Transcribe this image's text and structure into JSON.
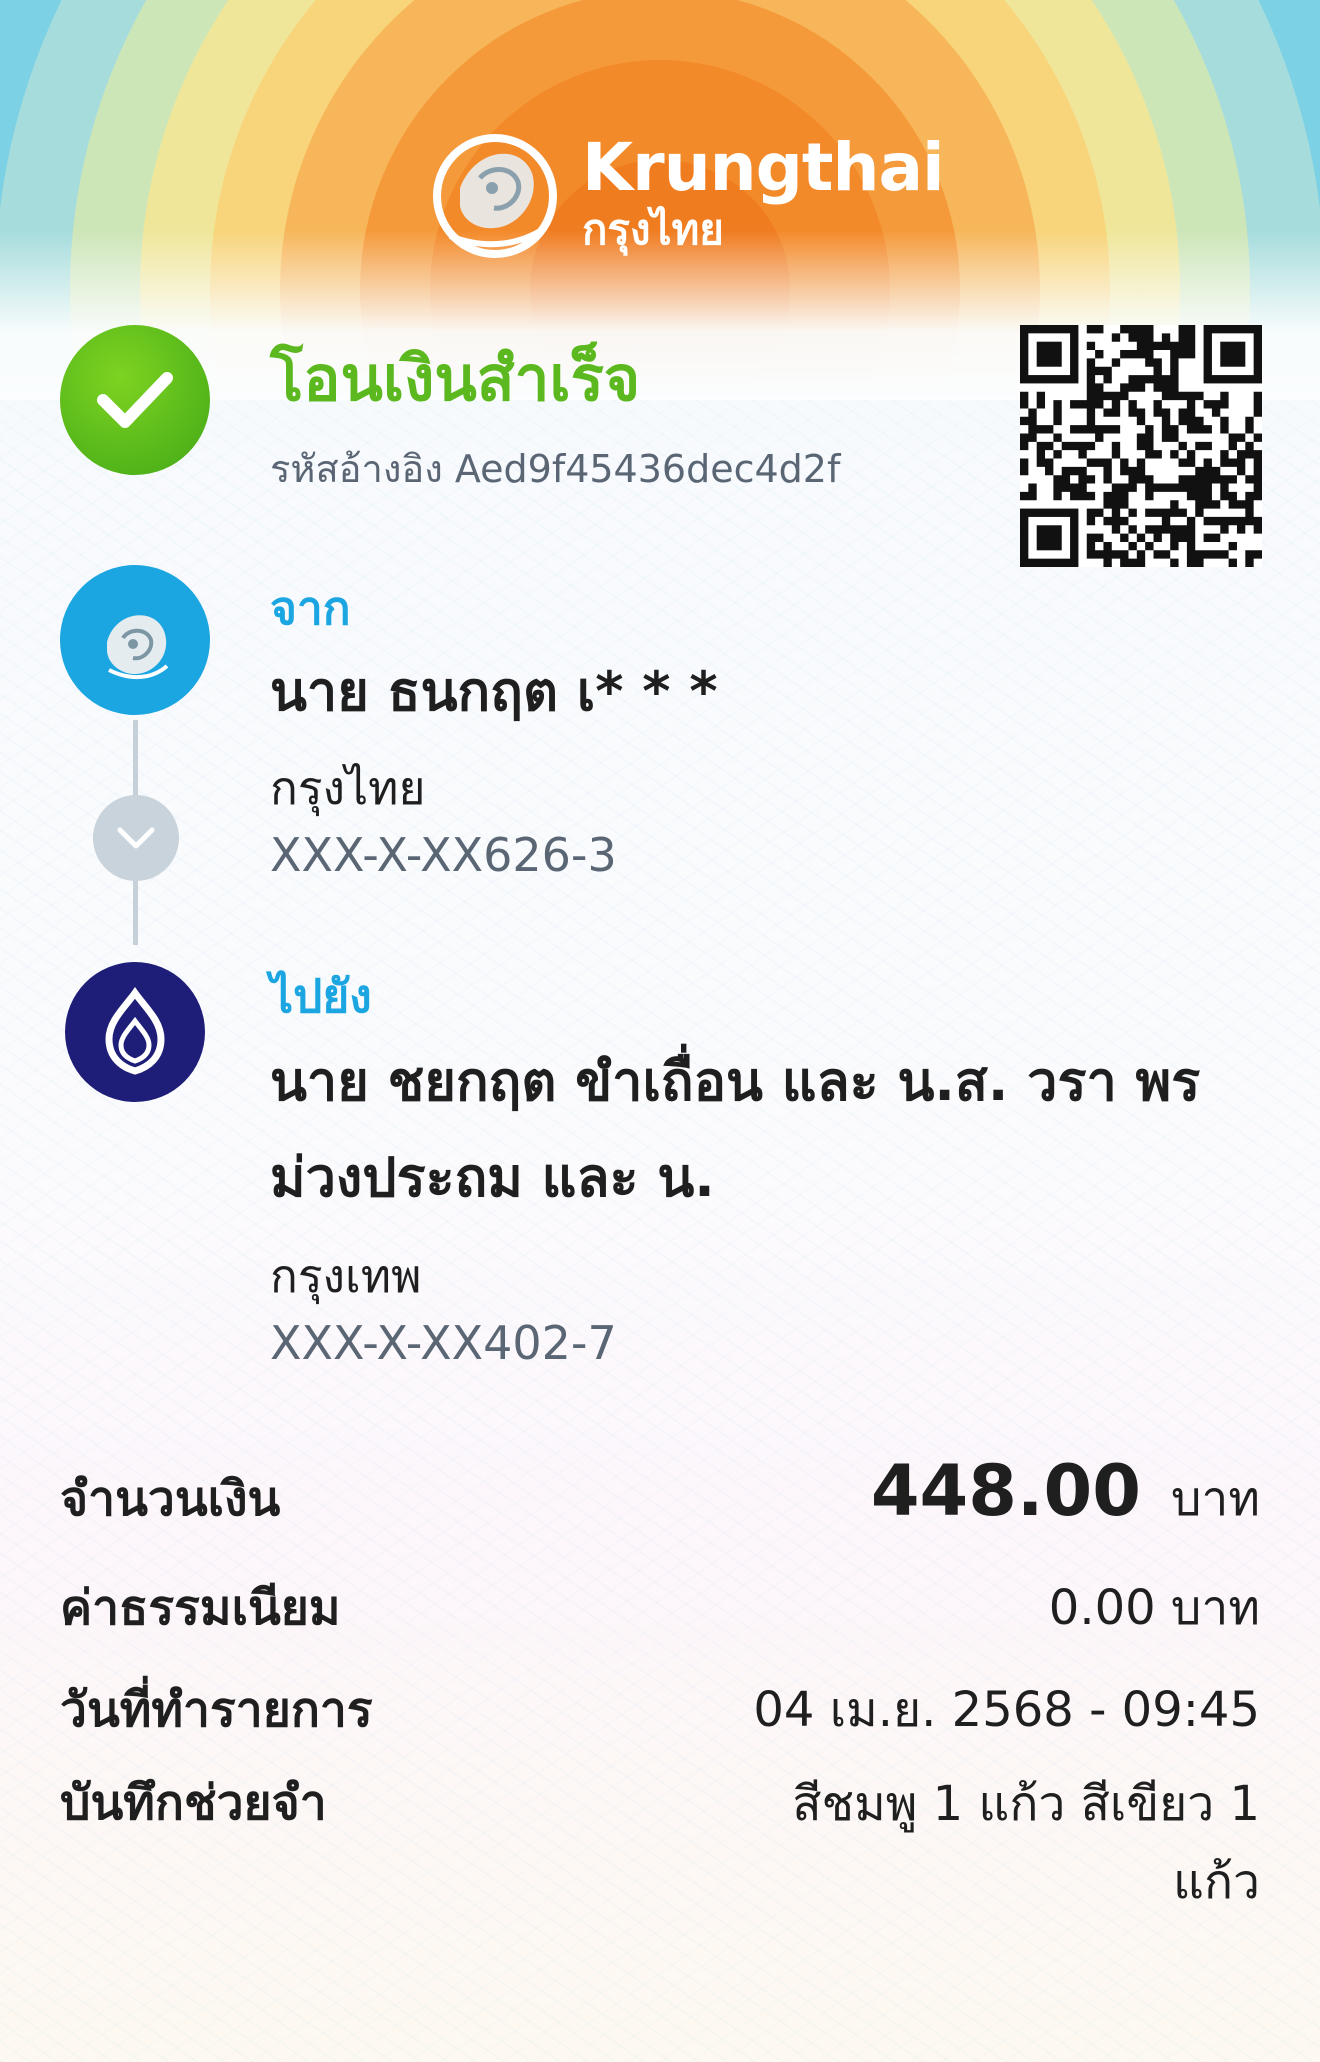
{
  "brand": {
    "name_en": "Krungthai",
    "name_th": "กรุงไทย"
  },
  "status": {
    "title": "โอนเงินสำเร็จ",
    "reference": "รหัสอ้างอิง Aed9f45436dec4d2f"
  },
  "from": {
    "label": "จาก",
    "name": "นาย ธนกฤต เ* * *",
    "bank": "กรุงไทย",
    "account": "XXX-X-XX626-3"
  },
  "to": {
    "label": "ไปยัง",
    "name": "นาย ชยกฤต ขำเถื่อน และ น.ส. วรา พร ม่วงประถม และ น.",
    "bank": "กรุงเทพ",
    "account": "XXX-X-XX402-7"
  },
  "details": {
    "amount_label": "จำนวนเงิน",
    "amount_value": "448.00",
    "amount_unit": "บาท",
    "fee_label": "ค่าธรรมเนียม",
    "fee_value": "0.00 บาท",
    "date_label": "วันที่ทำรายการ",
    "date_value": "04 เม.ย. 2568 - 09:45",
    "memo_label": "บันทึกช่วยจำ",
    "memo_value": "สีชมพู 1 แก้ว สีเขียว 1 แก้ว"
  },
  "icons": {
    "success": "check-icon",
    "from_bank": "krungthai-logo-icon",
    "to_bank": "bangkok-bank-logo-icon",
    "connector": "chevron-down-icon",
    "qr": "qr-code"
  },
  "colors": {
    "success_green": "#5bb81f",
    "accent_blue": "#1ba5e1",
    "bbl_navy": "#1e1e78"
  }
}
